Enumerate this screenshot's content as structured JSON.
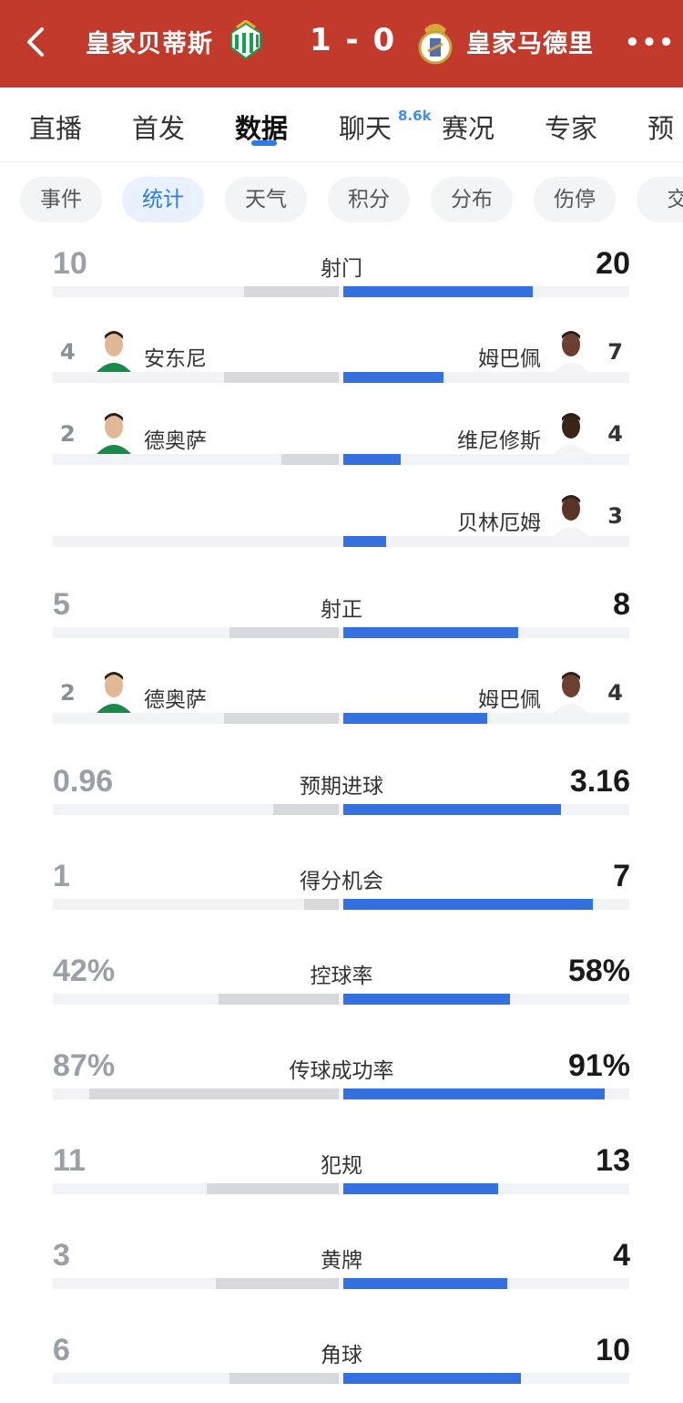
{
  "header": {
    "home_team": "皇家贝蒂斯",
    "score": "1 - 0",
    "away_team": "皇家马德里",
    "more_label": "•••",
    "colors": {
      "header_bg": "#c23a2c",
      "home_logo": "#17a050",
      "away_logo": "#c8a23a"
    }
  },
  "tabs": [
    {
      "label": "直播"
    },
    {
      "label": "首发"
    },
    {
      "label": "数据"
    },
    {
      "label": "聊天"
    },
    {
      "label": "赛况"
    },
    {
      "label": "专家"
    },
    {
      "label": "预"
    }
  ],
  "active_tab": "数据",
  "chat_badge": "8.6k",
  "chips": [
    {
      "label": "事件"
    },
    {
      "label": "统计"
    },
    {
      "label": "天气"
    },
    {
      "label": "积分"
    },
    {
      "label": "分布"
    },
    {
      "label": "伤停"
    },
    {
      "label": "交"
    }
  ],
  "active_chip": "统计",
  "stats": [
    {
      "label": "射门",
      "left": "10",
      "right": "20",
      "left_frac": 0.33,
      "right_frac": 0.66
    },
    {
      "label": "射正",
      "left": "5",
      "right": "8",
      "left_frac": 0.38,
      "right_frac": 0.61
    },
    {
      "label": "预期进球",
      "left": "0.96",
      "right": "3.16",
      "left_frac": 0.23,
      "right_frac": 0.76
    },
    {
      "label": "得分机会",
      "left": "1",
      "right": "7",
      "left_frac": 0.12,
      "right_frac": 0.87
    },
    {
      "label": "控球率",
      "left": "42%",
      "right": "58%",
      "left_frac": 0.42,
      "right_frac": 0.58
    },
    {
      "label": "传球成功率",
      "left": "87%",
      "right": "91%",
      "left_frac": 0.87,
      "right_frac": 0.91
    },
    {
      "label": "犯规",
      "left": "11",
      "right": "13",
      "left_frac": 0.46,
      "right_frac": 0.54
    },
    {
      "label": "黄牌",
      "left": "3",
      "right": "4",
      "left_frac": 0.43,
      "right_frac": 0.57
    },
    {
      "label": "角球",
      "left": "6",
      "right": "10",
      "left_frac": 0.38,
      "right_frac": 0.62
    }
  ],
  "player_rows": [
    {
      "left_num": "4",
      "left_name": "安东尼",
      "right_name": "姆巴佩",
      "right_num": "7",
      "left_frac": 0.4,
      "right_frac": 0.35
    },
    {
      "left_num": "2",
      "left_name": "德奥萨",
      "right_name": "维尼修斯",
      "right_num": "4",
      "left_frac": 0.2,
      "right_frac": 0.2
    },
    {
      "left_num": "",
      "left_name": "",
      "right_name": "贝林厄姆",
      "right_num": "3",
      "left_frac": 0.0,
      "right_frac": 0.15
    },
    {
      "left_num": "2",
      "left_name": "德奥萨",
      "right_name": "姆巴佩",
      "right_num": "4",
      "left_frac": 0.4,
      "right_frac": 0.5
    }
  ]
}
